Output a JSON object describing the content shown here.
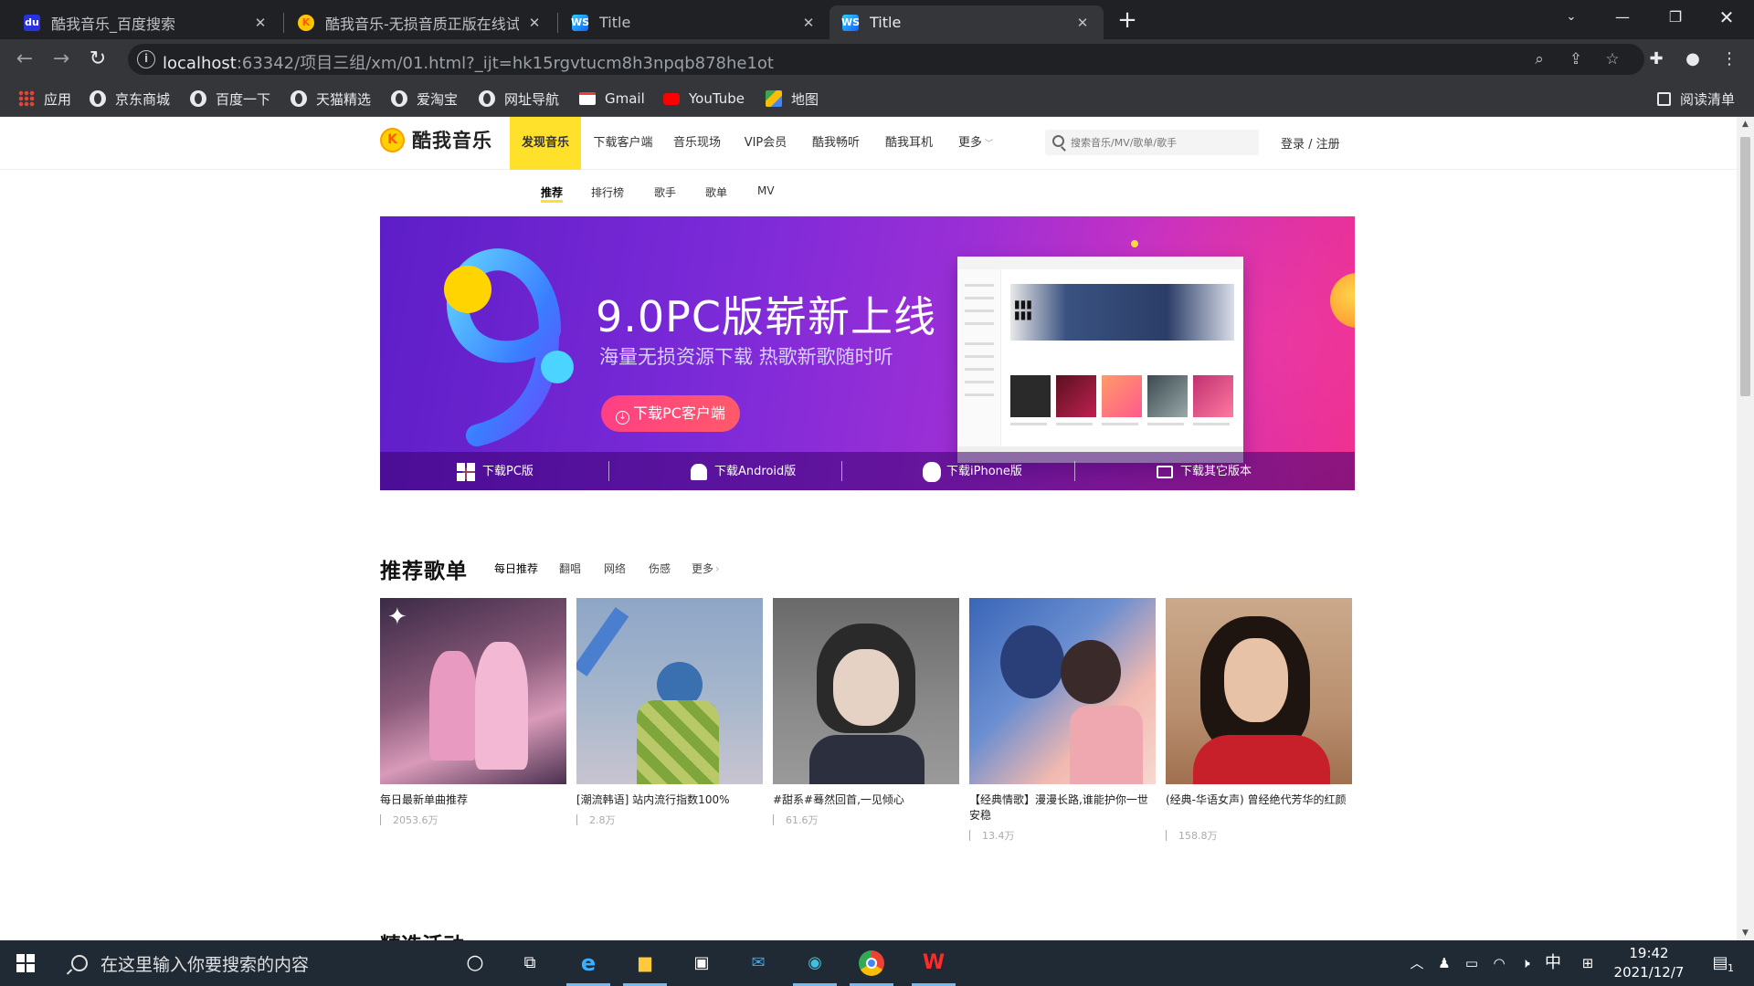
{
  "browser": {
    "tabs": [
      {
        "title": "酷我音乐_百度搜索",
        "icon": "baidu-icon",
        "active": false
      },
      {
        "title": "酷我音乐-无损音质正版在线试听",
        "icon": "kuwo-icon",
        "active": false
      },
      {
        "title": "Title",
        "icon": "webstorm-icon",
        "active": false
      },
      {
        "title": "Title",
        "icon": "webstorm-icon",
        "active": true
      }
    ],
    "url_host": "localhost",
    "url_rest": ":63342/项目三组/xm/01.html?_ijt=hk15rgvtucm8h3npqb878he1ot",
    "bookmarks": [
      {
        "label": "应用",
        "icon": "apps-grid-icon"
      },
      {
        "label": "京东商城",
        "icon": "globe-icon"
      },
      {
        "label": "百度一下",
        "icon": "globe-icon"
      },
      {
        "label": "天猫精选",
        "icon": "globe-icon"
      },
      {
        "label": "爱淘宝",
        "icon": "globe-icon"
      },
      {
        "label": "网址导航",
        "icon": "globe-icon"
      },
      {
        "label": "Gmail",
        "icon": "gmail-icon"
      },
      {
        "label": "YouTube",
        "icon": "youtube-icon"
      },
      {
        "label": "地图",
        "icon": "maps-icon"
      }
    ],
    "reading_list": "阅读清单"
  },
  "site": {
    "logo_text": "酷我音乐",
    "nav": [
      "发现音乐",
      "下载客户端",
      "音乐现场",
      "VIP会员",
      "酷我畅听",
      "酷我耳机",
      "更多"
    ],
    "search_placeholder": "搜索音乐/MV/歌单/歌手",
    "login": "登录 / 注册",
    "subnav": [
      "推荐",
      "排行榜",
      "歌手",
      "歌单",
      "MV"
    ]
  },
  "banner": {
    "title": "9.0PC版崭新上线",
    "subtitle": "海量无损资源下载 热歌新歌随时听",
    "button": "下载PC客户端",
    "downloads": [
      {
        "label": "下载PC版",
        "icon": "windows-icon"
      },
      {
        "label": "下载Android版",
        "icon": "android-icon"
      },
      {
        "label": "下载iPhone版",
        "icon": "apple-icon"
      },
      {
        "label": "下载其它版本",
        "icon": "monitor-icon"
      }
    ]
  },
  "playlists": {
    "title": "推荐歌单",
    "tabs": [
      "每日推荐",
      "翻唱",
      "网络",
      "伤感",
      "更多"
    ],
    "items": [
      {
        "title": "每日最新单曲推荐",
        "plays": "2053.6万"
      },
      {
        "title": "[潮流韩语] 站内流行指数100%",
        "plays": "2.8万"
      },
      {
        "title": "#甜系#蓦然回首,一见倾心",
        "plays": "61.6万"
      },
      {
        "title": "【经典情歌】漫漫长路,谁能护你一世安稳",
        "plays": "13.4万"
      },
      {
        "title": "(经典-华语女声) 曾经绝代芳华的红颜",
        "plays": "158.8万"
      }
    ]
  },
  "next_section": "精选活动",
  "taskbar": {
    "search_placeholder": "在这里输入你要搜索的内容",
    "ime": "中",
    "time": "19:42",
    "date": "2021/12/7",
    "notifications": "1"
  }
}
